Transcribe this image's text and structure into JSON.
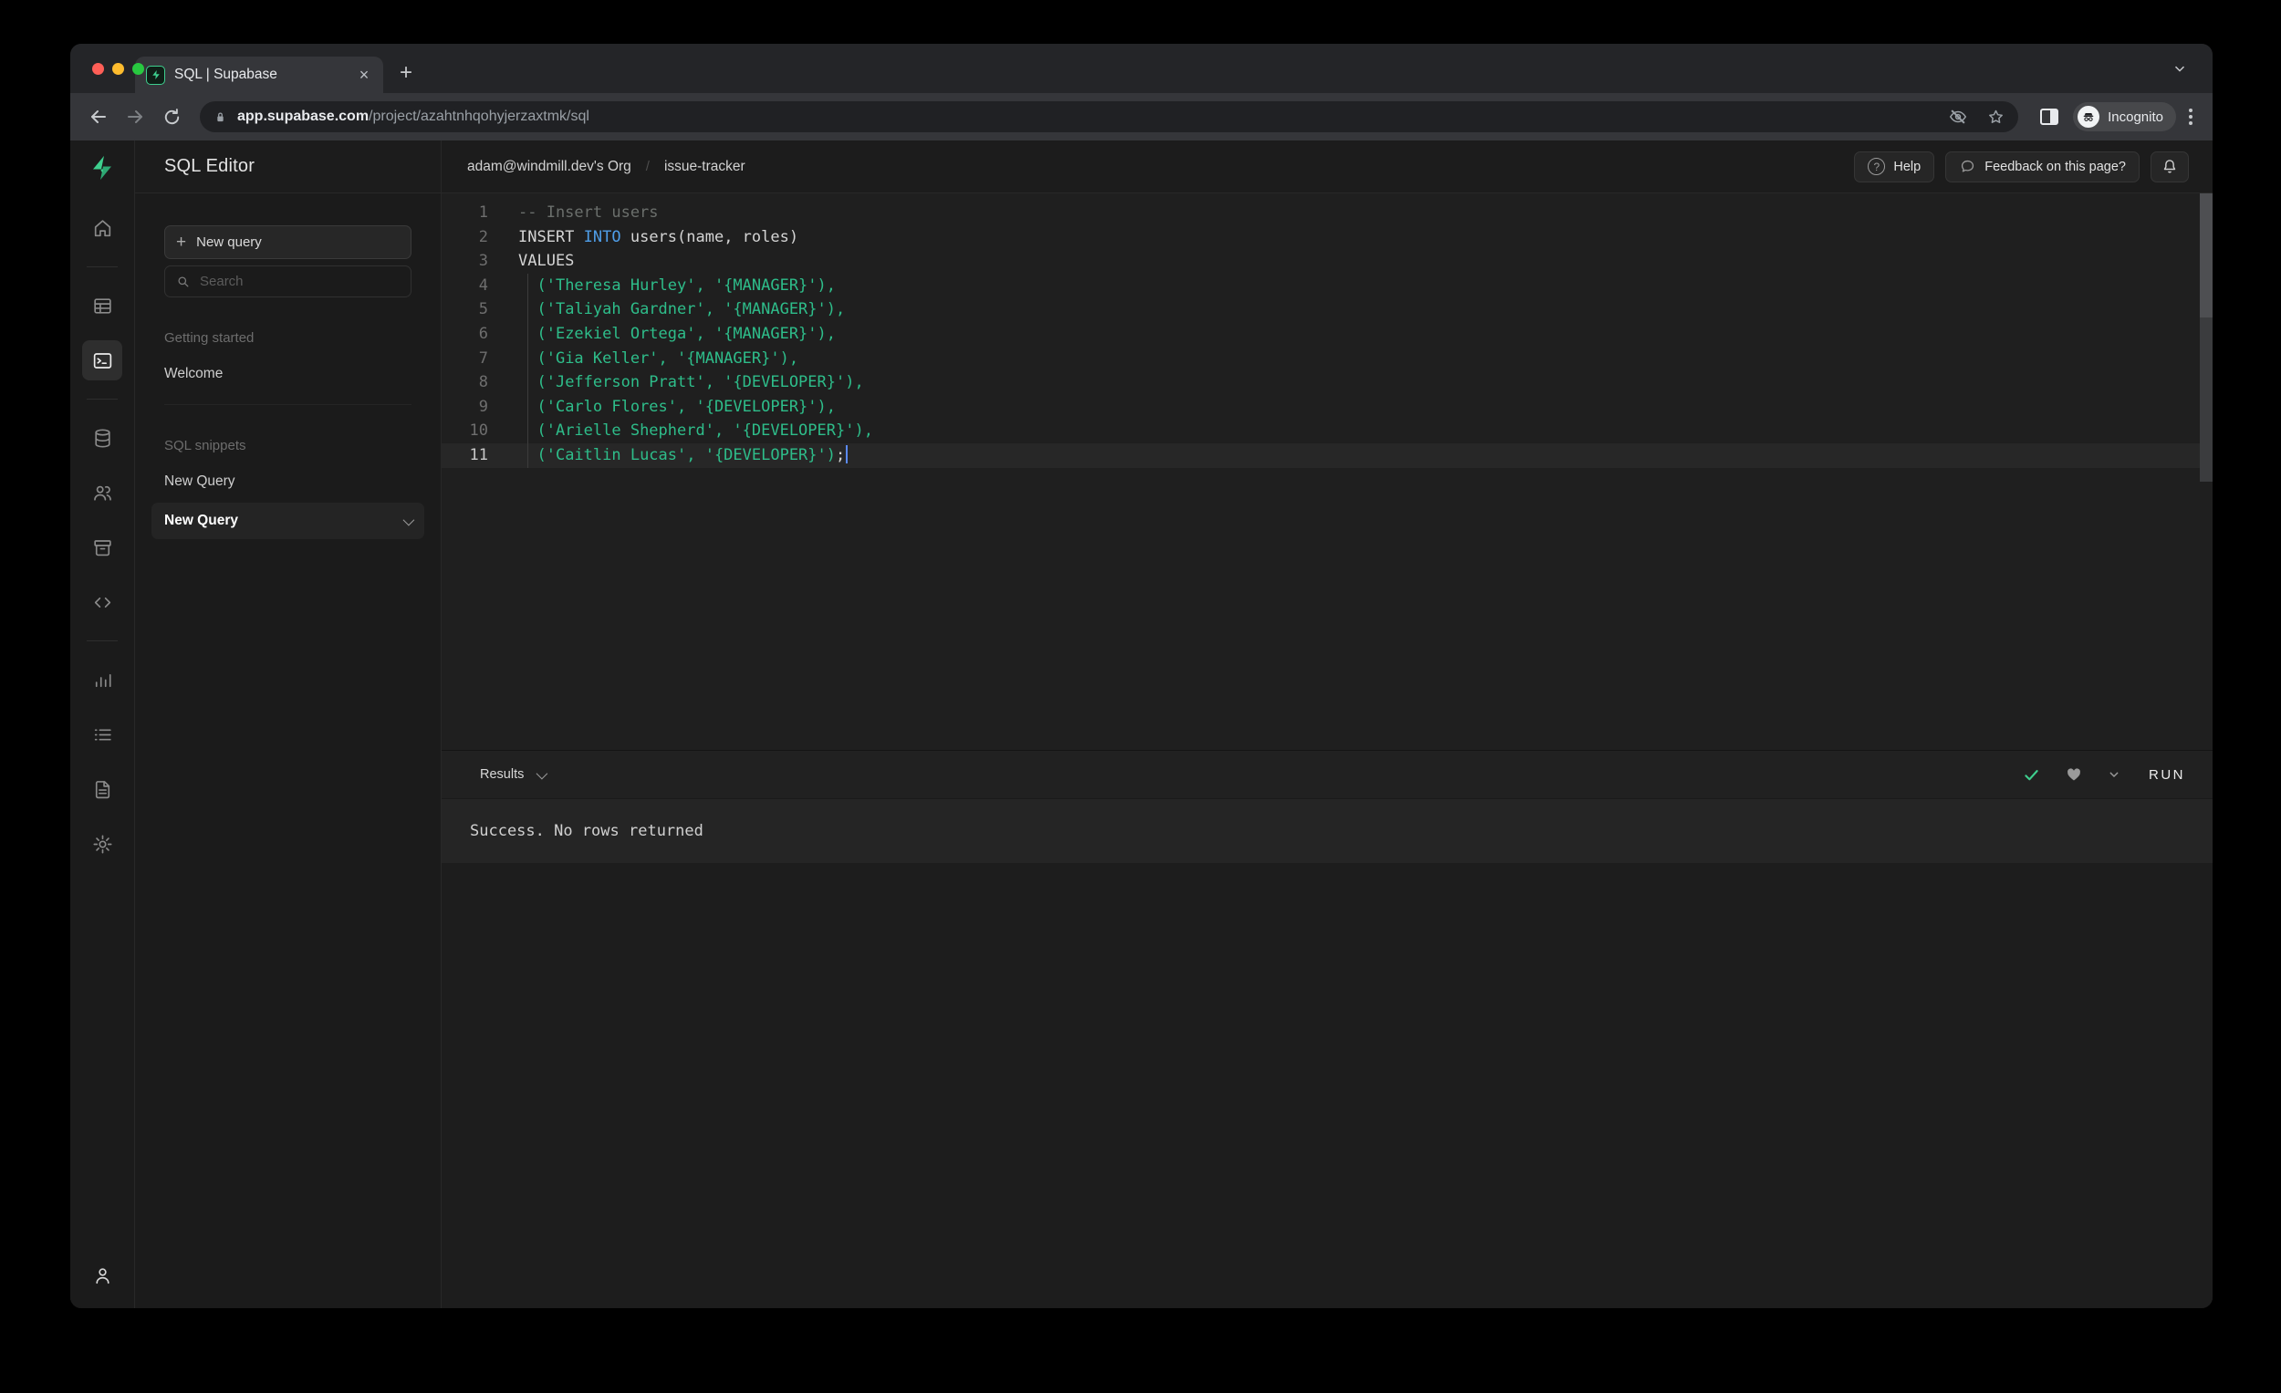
{
  "browser": {
    "traffic_lights": {
      "close": "#ff5f57",
      "minimize": "#febc2e",
      "zoom": "#28c840"
    },
    "tab": {
      "title": "SQL | Supabase",
      "close_glyph": "×",
      "new_tab_glyph": "+"
    },
    "url": {
      "domain": "app.supabase.com",
      "path": "/project/azahtnhqohyjerzaxtmk/sql"
    },
    "incognito_label": "Incognito"
  },
  "app": {
    "accent_color": "#3ecf8e",
    "header": {
      "title": "SQL Editor",
      "breadcrumb": {
        "org": "adam@windmill.dev's Org",
        "separator": "/",
        "project": "issue-tracker"
      },
      "help_label": "Help",
      "help_glyph": "?",
      "feedback_label": "Feedback on this page?"
    },
    "rail": {
      "items": [
        {
          "name": "home",
          "icon": "home-icon"
        },
        {
          "divider": true
        },
        {
          "name": "table-editor",
          "icon": "table-icon"
        },
        {
          "name": "sql-editor",
          "icon": "terminal-icon",
          "active": true
        },
        {
          "divider": true
        },
        {
          "name": "database",
          "icon": "database-icon"
        },
        {
          "name": "authentication",
          "icon": "users-icon"
        },
        {
          "name": "storage",
          "icon": "archive-icon"
        },
        {
          "name": "edge-functions",
          "icon": "code-icon"
        },
        {
          "divider": true
        },
        {
          "name": "reports",
          "icon": "bar-chart-icon"
        },
        {
          "name": "logs",
          "icon": "list-icon"
        },
        {
          "name": "api-docs",
          "icon": "file-icon"
        },
        {
          "name": "settings",
          "icon": "gear-icon"
        }
      ],
      "account": {
        "name": "account",
        "icon": "user-icon"
      }
    },
    "sidebar": {
      "new_query_button": "New query",
      "new_query_plus": "+",
      "search_placeholder": "Search",
      "sections": [
        {
          "label": "Getting started",
          "items": [
            {
              "label": "Welcome"
            }
          ]
        },
        {
          "label": "SQL snippets",
          "items": [
            {
              "label": "New Query"
            },
            {
              "label": "New Query",
              "active": true
            }
          ]
        }
      ]
    },
    "editor": {
      "lines": [
        {
          "n": "1",
          "tokens": [
            {
              "t": "-- Insert users",
              "y": "comment"
            }
          ]
        },
        {
          "n": "2",
          "tokens": [
            {
              "t": "INSERT ",
              "y": "plain"
            },
            {
              "t": "INTO",
              "y": "keyword"
            },
            {
              "t": " users(name, roles)",
              "y": "plain"
            }
          ]
        },
        {
          "n": "3",
          "tokens": [
            {
              "t": "VALUES",
              "y": "plain"
            }
          ]
        },
        {
          "n": "4",
          "tokens": [
            {
              "t": "  ",
              "y": "plain"
            },
            {
              "t": "('Theresa Hurley', '{MANAGER}'),",
              "y": "string"
            }
          ]
        },
        {
          "n": "5",
          "tokens": [
            {
              "t": "  ",
              "y": "plain"
            },
            {
              "t": "('Taliyah Gardner', '{MANAGER}'),",
              "y": "string"
            }
          ]
        },
        {
          "n": "6",
          "tokens": [
            {
              "t": "  ",
              "y": "plain"
            },
            {
              "t": "('Ezekiel Ortega', '{MANAGER}'),",
              "y": "string"
            }
          ]
        },
        {
          "n": "7",
          "tokens": [
            {
              "t": "  ",
              "y": "plain"
            },
            {
              "t": "('Gia Keller', '{MANAGER}'),",
              "y": "string"
            }
          ]
        },
        {
          "n": "8",
          "tokens": [
            {
              "t": "  ",
              "y": "plain"
            },
            {
              "t": "('Jefferson Pratt', '{DEVELOPER}'),",
              "y": "string"
            }
          ]
        },
        {
          "n": "9",
          "tokens": [
            {
              "t": "  ",
              "y": "plain"
            },
            {
              "t": "('Carlo Flores', '{DEVELOPER}'),",
              "y": "string"
            }
          ]
        },
        {
          "n": "10",
          "tokens": [
            {
              "t": "  ",
              "y": "plain"
            },
            {
              "t": "('Arielle Shepherd', '{DEVELOPER}'),",
              "y": "string"
            }
          ]
        },
        {
          "n": "11",
          "current": true,
          "cursor": true,
          "tokens": [
            {
              "t": "  ",
              "y": "plain"
            },
            {
              "t": "('Caitlin Lucas', '{DEVELOPER}')",
              "y": "string"
            },
            {
              "t": ";",
              "y": "plain"
            }
          ]
        }
      ]
    },
    "results": {
      "label": "Results",
      "run_label": "RUN",
      "message": "Success. No rows returned"
    }
  }
}
